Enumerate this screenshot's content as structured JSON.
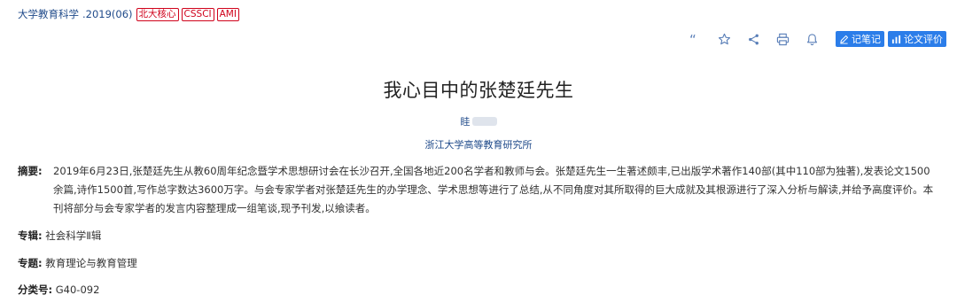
{
  "source": {
    "journal": "大学教育科学",
    "issue": ".2019(06)",
    "badges": [
      "北大核心",
      "CSSCI",
      "AMI"
    ]
  },
  "toolbar": {
    "icons": [
      "quote-icon",
      "star-icon",
      "share-icon",
      "print-icon",
      "bell-icon"
    ],
    "note_label": "记笔记",
    "review_label": "论文评价",
    "accent_color": "#2b7de9"
  },
  "article": {
    "title": "我心目中的张楚廷先生",
    "author": "眭",
    "affiliation": "浙江大学高等教育研究所"
  },
  "abstract": {
    "label": "摘要:",
    "text": "2019年6月23日,张楚廷先生从教60周年纪念暨学术思想研讨会在长沙召开,全国各地近200名学者和教师与会。张楚廷先生一生著述颇丰,已出版学术著作140部(其中110部为独著),发表论文1500余篇,诗作1500首,写作总字数达3600万字。与会专家学者对张楚廷先生的办学理念、学术思想等进行了总结,从不同角度对其所取得的巨大成就及其根源进行了深入分析与解读,并给予高度评价。本刊将部分与会专家学者的发言内容整理成一组笔谈,现予刊发,以飨读者。"
  },
  "meta": {
    "album_label": "专辑:",
    "album_value": "社会科学Ⅱ辑",
    "topic_label": "专题:",
    "topic_value": "教育理论与教育管理",
    "class_label": "分类号:",
    "class_value": "G40-092"
  }
}
